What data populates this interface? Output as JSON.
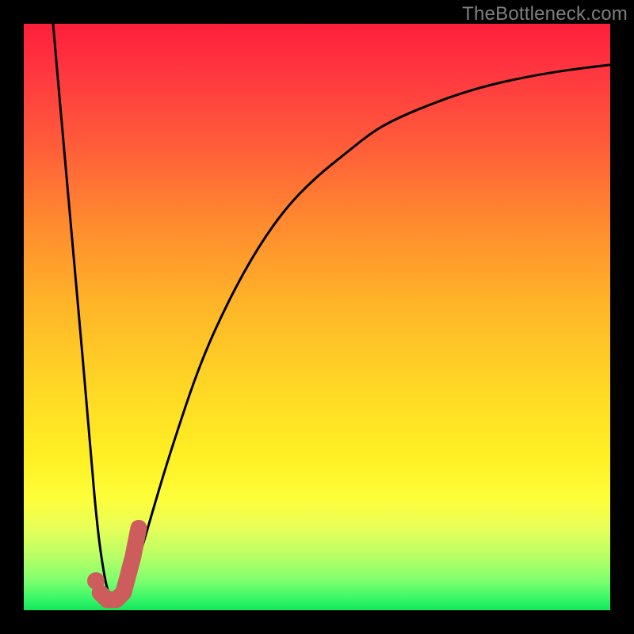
{
  "attribution": "TheBottleneck.com",
  "chart_data": {
    "type": "line",
    "title": "",
    "xlabel": "",
    "ylabel": "",
    "xlim": [
      0,
      100
    ],
    "ylim": [
      0,
      100
    ],
    "grid": false,
    "legend": false,
    "series": [
      {
        "name": "bottleneck-curve",
        "x": [
          5,
          7,
          9,
          11,
          12.5,
          14,
          15,
          16,
          17,
          18,
          20,
          22,
          25,
          30,
          35,
          40,
          45,
          50,
          55,
          60,
          65,
          70,
          75,
          80,
          85,
          90,
          95,
          100
        ],
        "values": [
          100,
          77,
          55,
          32,
          14,
          4,
          2,
          2,
          3,
          5,
          10,
          17,
          27,
          42,
          53,
          62,
          69,
          74,
          78,
          82,
          84.5,
          86.5,
          88.3,
          89.7,
          90.8,
          91.7,
          92.4,
          93
        ]
      }
    ],
    "marker": {
      "name": "tick-mark",
      "color": "#cd5c5c",
      "dot": {
        "x": 12.3,
        "y": 5.0
      },
      "hook": [
        {
          "x": 13.0,
          "y": 3.0
        },
        {
          "x": 14.2,
          "y": 1.8
        },
        {
          "x": 15.8,
          "y": 1.8
        },
        {
          "x": 17.0,
          "y": 3.0
        },
        {
          "x": 18.6,
          "y": 9.0
        },
        {
          "x": 19.6,
          "y": 14.0
        }
      ]
    },
    "gradient_axis": {
      "top_color": "#ff1f3a",
      "bottom_color": "#15e65c"
    }
  }
}
